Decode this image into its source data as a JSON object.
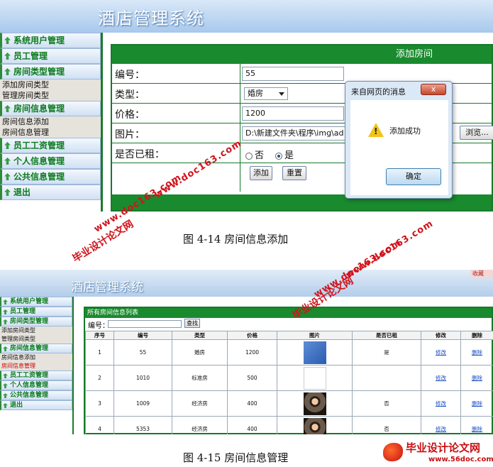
{
  "figure1": {
    "app_title": "酒店管理系统",
    "sidebar": [
      {
        "label": "系统用户管理",
        "subs": []
      },
      {
        "label": "员工管理",
        "subs": []
      },
      {
        "label": "房间类型管理",
        "subs": [
          "添加房间类型",
          "管理房间类型"
        ]
      },
      {
        "label": "房间信息管理",
        "subs": [
          "房间信息添加",
          "房间信息管理"
        ]
      },
      {
        "label": "员工工资管理",
        "subs": []
      },
      {
        "label": "个人信息管理",
        "subs": []
      },
      {
        "label": "公共信息管理",
        "subs": []
      },
      {
        "label": "退出",
        "subs": []
      }
    ],
    "form": {
      "title": "添加房间",
      "number_label": "编号：",
      "number_value": "55",
      "type_label": "类型：",
      "type_value": "婚房",
      "price_label": "价格：",
      "price_value": "1200",
      "image_label": "图片：",
      "image_value": "D:\\新建文件夹\\程序\\img\\ad",
      "browse_label": "浏览...",
      "rented_label": "是否已租：",
      "rented_no": "否",
      "rented_yes": "是",
      "add_button": "添加",
      "reset_button": "重置"
    },
    "dialog": {
      "title": "来自网页的消息",
      "message": "添加成功",
      "ok": "确定"
    },
    "caption": "图 4-14 房间信息添加"
  },
  "figure2": {
    "app_title": "酒店管理系统",
    "corner_text": "收藏",
    "sidebar": [
      {
        "label": "系统用户管理",
        "subs": []
      },
      {
        "label": "员工管理",
        "subs": []
      },
      {
        "label": "房间类型管理",
        "subs": [
          "添加房间类型",
          "管理房间类型"
        ]
      },
      {
        "label": "房间信息管理",
        "subs": [
          "房间信息添加",
          "房间信息管理"
        ]
      },
      {
        "label": "员工工资管理",
        "subs": []
      },
      {
        "label": "个人信息管理",
        "subs": []
      },
      {
        "label": "公共信息管理",
        "subs": []
      },
      {
        "label": "退出",
        "subs": []
      }
    ],
    "list_title": "所有房间信息列表",
    "search_label": "编号：",
    "search_button": "查找",
    "columns": [
      "序号",
      "编号",
      "类型",
      "价格",
      "图片",
      "是否已租",
      "修改",
      "删除"
    ],
    "rows": [
      {
        "seq": "1",
        "number": "55",
        "type": "婚房",
        "price": "1200",
        "image": "blue",
        "rented": "是",
        "edit": "修改",
        "delete": "删除"
      },
      {
        "seq": "2",
        "number": "1010",
        "type": "标准房",
        "price": "500",
        "image": "white",
        "rented": "",
        "edit": "修改",
        "delete": "删除"
      },
      {
        "seq": "3",
        "number": "1009",
        "type": "经济房",
        "price": "400",
        "image": "photo",
        "rented": "否",
        "edit": "修改",
        "delete": "删除"
      },
      {
        "seq": "4",
        "number": "5353",
        "type": "经济房",
        "price": "400",
        "image": "photo",
        "rented": "否",
        "edit": "修改",
        "delete": "删除"
      }
    ],
    "caption": "图 4-15 房间信息管理"
  },
  "watermarks": {
    "brand_cn": "毕业设计论文网",
    "url": "www.doc163.com",
    "logo_title": "毕业设计论文网",
    "logo_url": "www.56doc.com"
  },
  "colors": {
    "green": "#1a8a2e",
    "watermark_red": "#d1131b"
  }
}
